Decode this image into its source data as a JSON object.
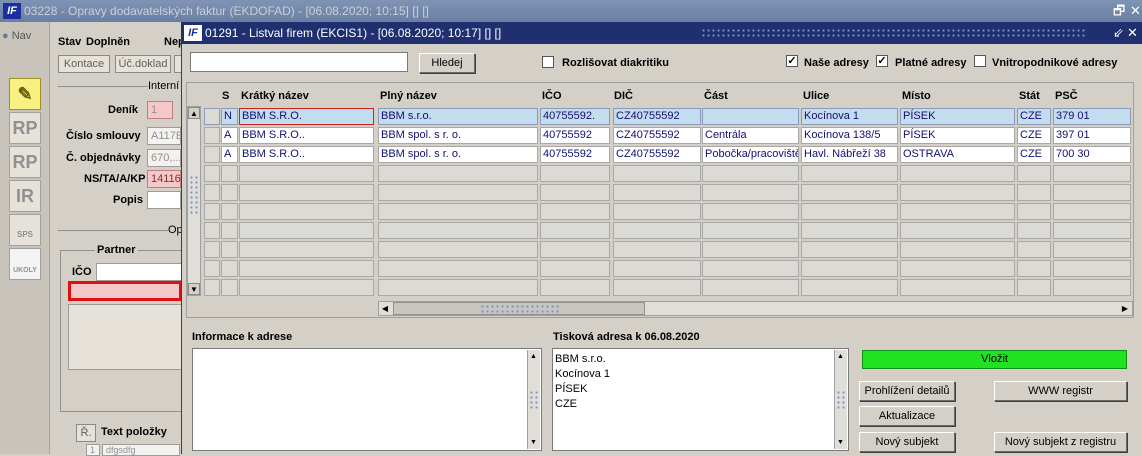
{
  "bg_window": {
    "title": "03228 - Opravy dodavatelských faktur (EKDOFAD) - [06.08.2020; 10:15]  []  []",
    "logo": "IF",
    "nav_label": "Nav",
    "stav_label": "Stav",
    "doplnen_label": "Doplněn",
    "nep_label": "Nep",
    "kontace_btn": "Kontace",
    "ucdoklad_btn": "Úč.doklad",
    "interni_label": "Interní",
    "denik_label": "Deník",
    "denik_value": "1",
    "cislo_smlouvy_label": "Číslo smlouvy",
    "cislo_smlouvy_value": "A117E",
    "c_objednavky_label": "Č. objednávky",
    "c_objednavky_value": "670,...",
    "ns_label": "NS/TA/A/KP",
    "ns_value": "14116",
    "popis_label": "Popis",
    "opis_label": "Opis pr",
    "partner_label": "Partner",
    "ico_label": "IČO",
    "r_btn": "Ř.",
    "text_polozky_label": "Text položky",
    "row1_num": "1",
    "row1_text": "dfgsdfg",
    "tool_icons": [
      "pencil-icon",
      "RP",
      "RP",
      "IR",
      "SPS",
      "UKOLY"
    ]
  },
  "dialog": {
    "logo": "IF",
    "title": "01291 - Listval firem (EKCIS1) - [06.08.2020; 10:17]  []  []",
    "search_placeholder": "",
    "hledej_btn": "Hledej",
    "rozlisovat_label": "Rozlišovat diakritiku",
    "rozlisovat_checked": false,
    "nase_adresy_label": "Naše adresy",
    "nase_adresy_checked": true,
    "platne_adresy_label": "Platné adresy",
    "platne_adresy_checked": true,
    "vnitro_label": "Vnitropodnikové adresy",
    "vnitro_checked": false,
    "columns": [
      "S",
      "Krátký název",
      "Plný název",
      "IČO",
      "DIČ",
      "Část",
      "Ulice",
      "Místo",
      "Stát",
      "PSČ"
    ],
    "rows": [
      [
        "N",
        "BBM S.R.O.",
        "BBM s.r.o.",
        "40755592.",
        "CZ40755592",
        "",
        "Kocínova 1",
        "PÍSEK",
        "CZE",
        "379 01"
      ],
      [
        "A",
        "BBM S.R.O..",
        "BBM spol. s r. o.",
        "40755592",
        "CZ40755592",
        "Centrála",
        "Kocínova 138/5",
        "PÍSEK",
        "CZE",
        "397 01"
      ],
      [
        "A",
        "BBM S.R.O..",
        "BBM spol. s r. o.",
        "40755592",
        "CZ40755592",
        "Pobočka/pracoviště",
        "Havl. Nábřeží 38",
        "OSTRAVA",
        "CZE",
        "700 30"
      ]
    ],
    "info_label": "Informace k adrese",
    "tiskova_label": "Tisková adresa k 06.08.2020",
    "tiskova_lines": [
      "BBM s.r.o.",
      "Kocínova 1",
      "PÍSEK",
      "CZE"
    ],
    "vlozit_btn": "Vložit",
    "prohlizeni_btn": "Prohlížení detailů",
    "www_btn": "WWW registr",
    "aktualizace_btn": "Aktualizace",
    "novy_subjekt_btn": "Nový subjekt",
    "novy_registr_btn": "Nový subjekt z registru",
    "colors": {
      "vlozit_green": "#22e022",
      "title_blue": "#1f2f70",
      "selected_row": "#c4dcf0"
    }
  }
}
